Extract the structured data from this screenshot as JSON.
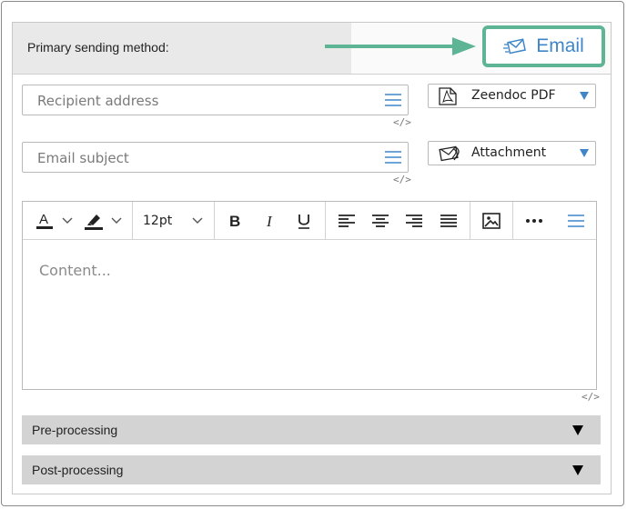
{
  "header": {
    "label": "Primary sending method:",
    "method_label": "Email",
    "method_icon": "envelope-send-icon",
    "highlight_color": "#5db596",
    "accent_color": "#3f86c8"
  },
  "recipient": {
    "placeholder": "Recipient address",
    "code_tag": "</>"
  },
  "format_select": {
    "icon": "pdf-icon",
    "value": "Zeendoc PDF"
  },
  "subject": {
    "placeholder": "Email subject",
    "code_tag": "</>"
  },
  "attach_select": {
    "icon": "attachment-icon",
    "value": "Attachment"
  },
  "editor": {
    "font_size": "12pt",
    "placeholder": "Content...",
    "code_tag": "</>"
  },
  "sections": {
    "pre": "Pre-processing",
    "post": "Post-processing"
  }
}
